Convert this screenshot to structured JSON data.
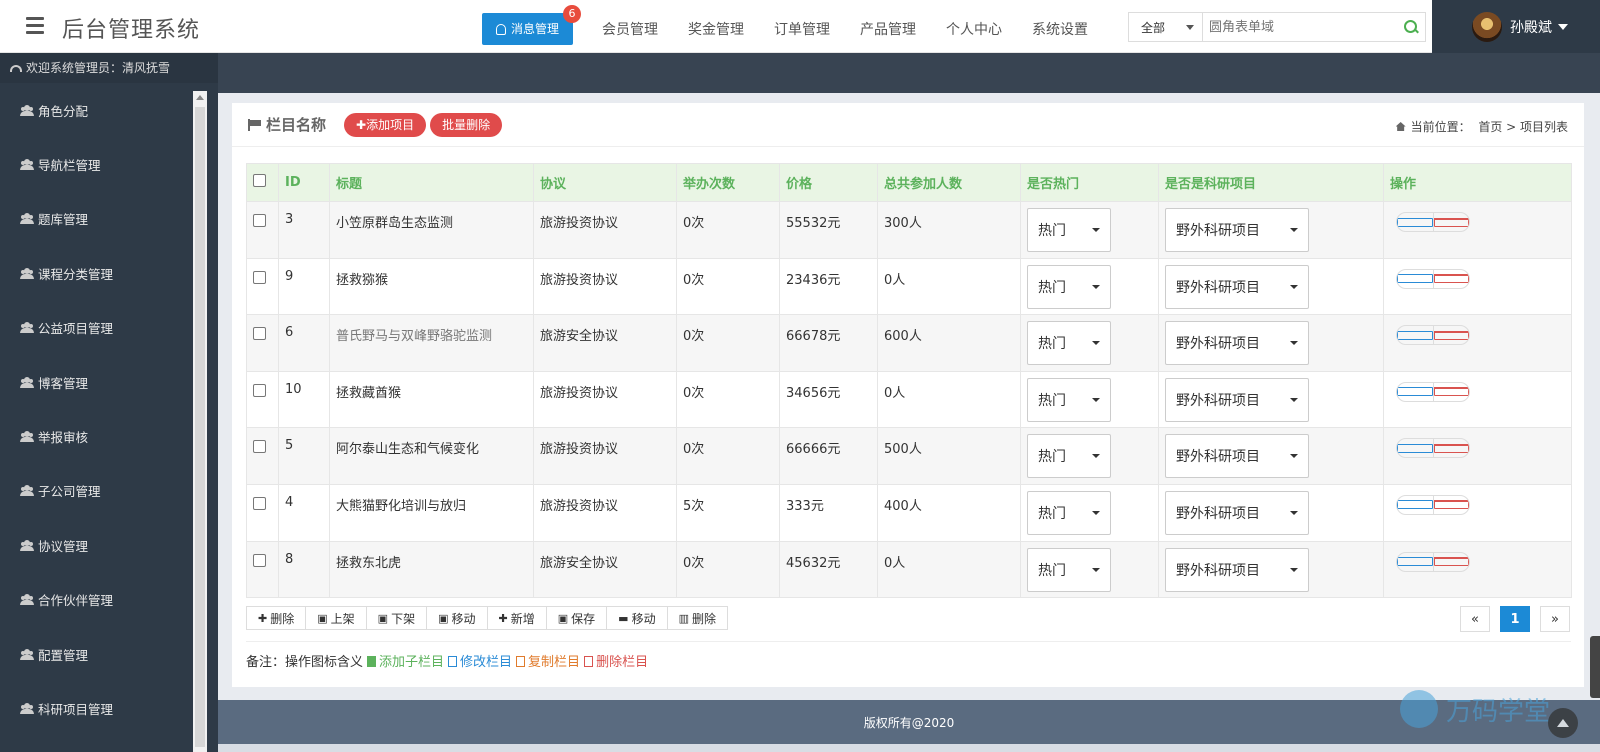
{
  "header": {
    "brand": "后台管理系统",
    "msg_button": "消息管理",
    "msg_badge": "6",
    "nav": [
      "会员管理",
      "奖金管理",
      "订单管理",
      "产品管理",
      "个人中心",
      "系统设置"
    ],
    "search": {
      "scope": "全部",
      "placeholder": "圆角表单域"
    },
    "user": "孙殿斌"
  },
  "sidebar": {
    "welcome": "欢迎系统管理员：清风抚雪",
    "items": [
      "角色分配",
      "导航栏管理",
      "题库管理",
      "课程分类管理",
      "公益项目管理",
      "博客管理",
      "举报审核",
      "子公司管理",
      "协议管理",
      "合作伙伴管理",
      "配置管理",
      "科研项目管理"
    ]
  },
  "panel": {
    "title": "栏目名称",
    "add_button": "✚添加项目",
    "batch_delete_button": "批量删除",
    "crumb_label": "当前位置：",
    "crumb_path": "首页 > 项目列表"
  },
  "table": {
    "headers": [
      "ID",
      "标题",
      "协议",
      "举办次数",
      "价格",
      "总共参加人数",
      "是否热门",
      "是否是科研项目",
      "操作"
    ],
    "rows": [
      {
        "id": "3",
        "title": "小笠原群岛生态监测",
        "protocol": "旅游投资协议",
        "times": "0次",
        "price": "55532元",
        "people": "300人",
        "hot": "热门",
        "research": "野外科研项目"
      },
      {
        "id": "9",
        "title": "拯救猕猴",
        "protocol": "旅游投资协议",
        "times": "0次",
        "price": "23436元",
        "people": "0人",
        "hot": "热门",
        "research": "野外科研项目"
      },
      {
        "id": "6",
        "title": "普氏野马与双峰野骆驼监测",
        "protocol": "旅游安全协议",
        "times": "0次",
        "price": "66678元",
        "people": "600人",
        "hot": "热门",
        "research": "野外科研项目"
      },
      {
        "id": "10",
        "title": "拯救藏酋猴",
        "protocol": "旅游投资协议",
        "times": "0次",
        "price": "34656元",
        "people": "0人",
        "hot": "热门",
        "research": "野外科研项目"
      },
      {
        "id": "5",
        "title": "阿尔泰山生态和气候变化",
        "protocol": "旅游投资协议",
        "times": "0次",
        "price": "66666元",
        "people": "500人",
        "hot": "热门",
        "research": "野外科研项目"
      },
      {
        "id": "4",
        "title": "大熊猫野化培训与放归",
        "protocol": "旅游投资协议",
        "times": "5次",
        "price": "333元",
        "people": "400人",
        "hot": "热门",
        "research": "野外科研项目"
      },
      {
        "id": "8",
        "title": "拯救东北虎",
        "protocol": "旅游安全协议",
        "times": "0次",
        "price": "45632元",
        "people": "0人",
        "hot": "热门",
        "research": "野外科研项目"
      }
    ]
  },
  "toolbar": [
    {
      "icon": "✚",
      "label": "删除"
    },
    {
      "icon": "▣",
      "label": "上架"
    },
    {
      "icon": "▣",
      "label": "下架"
    },
    {
      "icon": "▣",
      "label": "移动"
    },
    {
      "icon": "✚",
      "label": "新增"
    },
    {
      "icon": "▣",
      "label": "保存"
    },
    {
      "icon": "▬",
      "label": "移动"
    },
    {
      "icon": "▥",
      "label": "删除"
    }
  ],
  "pager": {
    "prev": "«",
    "current": "1",
    "next": "»"
  },
  "note": {
    "label": "备注：操作图标含义",
    "add": "添加子栏目",
    "edit": "修改栏目",
    "copy": "复制栏目",
    "delete": "删除栏目"
  },
  "footer": {
    "text": "版权所有@2020"
  },
  "watermark": {
    "text": "万码学堂"
  },
  "colors": {
    "primary": "#1c8ad6",
    "danger": "#e04b4b",
    "sidebar": "#2e3a47",
    "table_head": "#e9f5e4",
    "head_text": "#5cb25c"
  }
}
